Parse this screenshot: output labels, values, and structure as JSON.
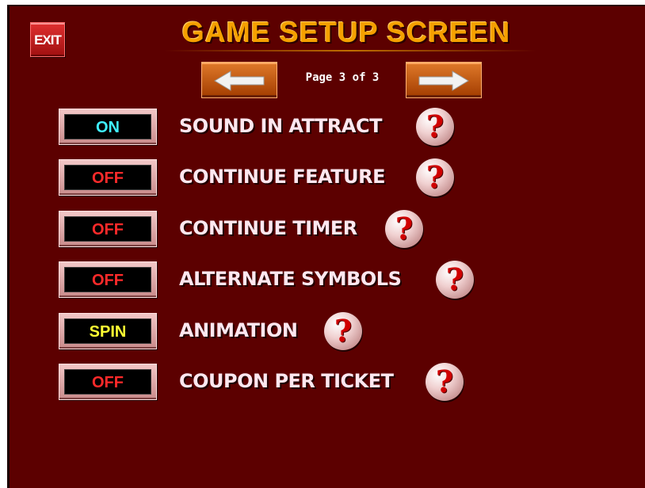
{
  "header": {
    "exit_label": "EXIT",
    "title": "GAME SETUP SCREEN",
    "page_indicator": "Page 3 of 3"
  },
  "colors": {
    "background": "#5c0000",
    "on": "#3ff0ff",
    "off": "#ff2a2a",
    "spin": "#ffff33",
    "title": "#f5a000"
  },
  "settings": [
    {
      "label": "SOUND IN ATTRACT",
      "value": "ON",
      "value_color": "#3ff0ff",
      "help_icon": "help-question-icon"
    },
    {
      "label": "CONTINUE FEATURE",
      "value": "OFF",
      "value_color": "#ff2a2a",
      "help_icon": "help-question-icon"
    },
    {
      "label": "CONTINUE TIMER",
      "value": "OFF",
      "value_color": "#ff2a2a",
      "help_icon": "help-question-icon"
    },
    {
      "label": "ALTERNATE SYMBOLS",
      "value": "OFF",
      "value_color": "#ff2a2a",
      "help_icon": "help-question-icon"
    },
    {
      "label": "ANIMATION",
      "value": "SPIN",
      "value_color": "#ffff33",
      "help_icon": "help-question-icon"
    },
    {
      "label": "COUPON PER TICKET",
      "value": "OFF",
      "value_color": "#ff2a2a",
      "help_icon": "help-question-icon"
    }
  ],
  "help_glyph": "?"
}
